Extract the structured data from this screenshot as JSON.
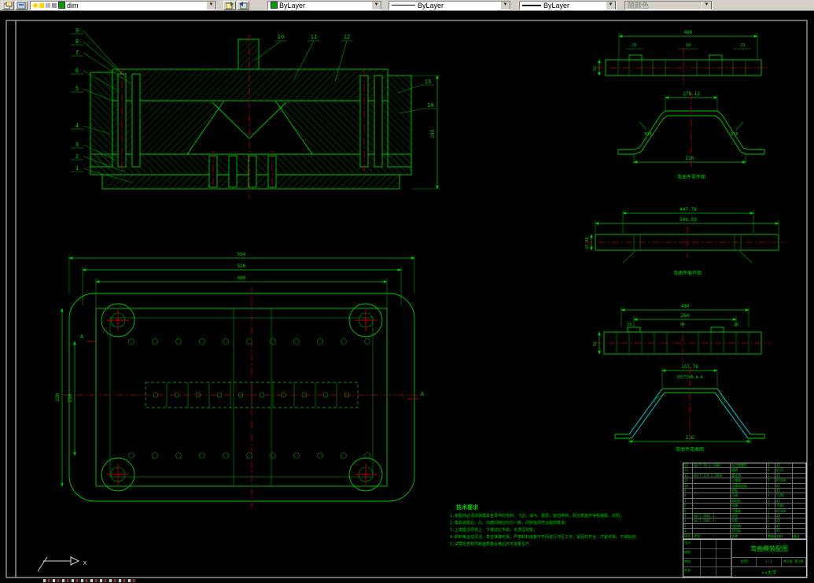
{
  "toolbar": {
    "layer_value": "dim",
    "color_value": "ByLayer",
    "linetype_value": "ByLayer",
    "lineweight_value": "ByLayer",
    "plotstyle_value": "随颜色",
    "dropdown_glyph": "▼"
  },
  "callouts": [
    "1",
    "2",
    "3",
    "4",
    "5",
    "6",
    "7",
    "8",
    "9",
    "10",
    "11",
    "12",
    "13",
    "14"
  ],
  "section_view": {
    "dim_right": "245"
  },
  "plan_view": {
    "dim_width_outer": "584",
    "dim_width_mid": "520",
    "dim_width_inner": "480",
    "dim_height_left1": "320",
    "dim_height_left2": "250",
    "section_label": "A"
  },
  "views": {
    "strip_top": {
      "w": "480",
      "d1": "29",
      "d2": "84",
      "d3": "29",
      "h": "52"
    },
    "bend_part": {
      "top": "178.12",
      "bottom": "216",
      "r_left": "R10",
      "r_right": "R10",
      "caption": "弯曲件零件图"
    },
    "flat": {
      "d1": "447.78",
      "d2": "546.59",
      "left": "23.48",
      "caption": "弯曲件展开图"
    },
    "strip_bottom": {
      "w": "480",
      "inner": "264",
      "h": "52",
      "d1": "29",
      "d2": "84",
      "d3": "29"
    },
    "section_aa": {
      "dim": "157.78",
      "label": "SECTION A-A",
      "bottom": "216",
      "caption": "弯曲件弯曲图"
    }
  },
  "notes": {
    "title": "技术要求",
    "lines": [
      "1.装配前必须清除模具各零件的毛刺、飞边、油污、铁屑，锐边倒钝，配合表面不得有磕碰、划伤；",
      "2.模具装配后，凸、凹模间隙应均匀一致，间隙值须符合图样要求；",
      "3.上模座沿导柱上、下移动应平稳，无滞涩现象；",
      "4.卸料板运动灵活，复位准确可靠，严禁卸料装置不齐而进行冲压工作，紧固件齐全、拧紧可靠，不得松动；",
      "5.试模检查制件断面质量合格后方可批量生产。"
    ]
  },
  "title_block": {
    "bom_header": {
      "no": "序号",
      "code": "代号",
      "name": "名称",
      "qty": "数量",
      "mat": "材料",
      "note": "备注"
    },
    "bom_rows": [
      {
        "no": "14",
        "code": "GB/T 70.1-2000",
        "name": "内六角螺钉",
        "qty": "4",
        "mat": "45",
        "note": ""
      },
      {
        "no": "13",
        "code": "",
        "name": "模柄",
        "qty": "1",
        "mat": "Q235",
        "note": ""
      },
      {
        "no": "12",
        "code": "GB/T 119.1-2000",
        "name": "圆柱销",
        "qty": "2",
        "mat": "45",
        "note": ""
      },
      {
        "no": "11",
        "code": "",
        "name": "上模座",
        "qty": "1",
        "mat": "HT200",
        "note": ""
      },
      {
        "no": "10",
        "code": "",
        "name": "凸模固定板",
        "qty": "1",
        "mat": "45",
        "note": ""
      },
      {
        "no": "9",
        "code": "",
        "name": "垫板",
        "qty": "1",
        "mat": "45",
        "note": ""
      },
      {
        "no": "8",
        "code": "",
        "name": "凸模",
        "qty": "1",
        "mat": "T10A",
        "note": ""
      },
      {
        "no": "7",
        "code": "",
        "name": "卸料板",
        "qty": "1",
        "mat": "45",
        "note": ""
      },
      {
        "no": "6",
        "code": "",
        "name": "凹模",
        "qty": "1",
        "mat": "T10A",
        "note": ""
      },
      {
        "no": "5",
        "code": "",
        "name": "下模座",
        "qty": "1",
        "mat": "HT200",
        "note": ""
      },
      {
        "no": "4",
        "code": "GB/T 2861.1",
        "name": "导柱",
        "qty": "2",
        "mat": "20",
        "note": ""
      },
      {
        "no": "3",
        "code": "GB/T 2861.3",
        "name": "导套",
        "qty": "2",
        "mat": "20",
        "note": ""
      },
      {
        "no": "2",
        "code": "",
        "name": "挡料销",
        "qty": "2",
        "mat": "45",
        "note": ""
      },
      {
        "no": "1",
        "code": "",
        "name": "定位板",
        "qty": "2",
        "mat": "45",
        "note": ""
      }
    ],
    "drawing_name": "弯曲模装配图",
    "scale_label": "比例",
    "scale_value": "1:1",
    "sheet_info": "共1张 第1张",
    "org": "××大学",
    "sign_rows": [
      {
        "a": "设计",
        "b": "",
        "c": ""
      },
      {
        "a": "校核",
        "b": "",
        "c": ""
      },
      {
        "a": "审核",
        "b": "",
        "c": ""
      },
      {
        "a": "批准",
        "b": "",
        "c": ""
      }
    ]
  },
  "ucs": {
    "x_label": "X"
  }
}
